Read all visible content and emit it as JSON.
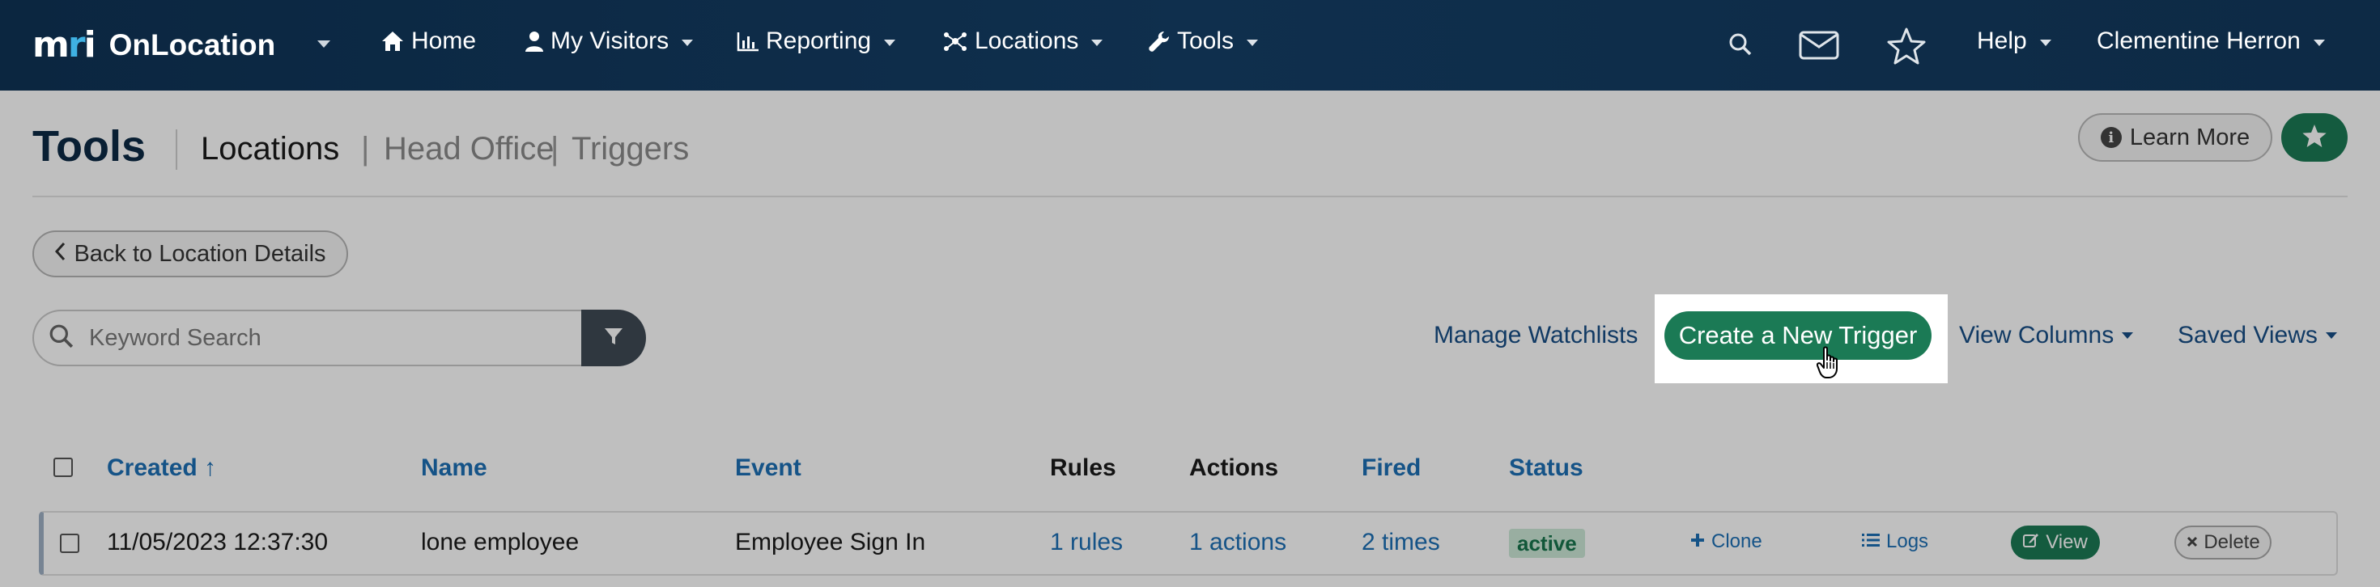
{
  "brand": {
    "logo_text": "mri",
    "product": "OnLocation"
  },
  "nav": {
    "items": [
      {
        "label": "Home",
        "icon": "home-icon"
      },
      {
        "label": "My Visitors",
        "icon": "user-icon"
      },
      {
        "label": "Reporting",
        "icon": "bar-chart-icon"
      },
      {
        "label": "Locations",
        "icon": "network-icon"
      },
      {
        "label": "Tools",
        "icon": "wrench-icon"
      }
    ],
    "help": "Help",
    "user": "Clementine Herron"
  },
  "page": {
    "title": "Tools",
    "breadcrumb": {
      "main": "Locations",
      "sep": "|",
      "sub1": "Head Office",
      "sub2": "Triggers"
    },
    "learn_more": "Learn More",
    "back_button": "Back to Location Details"
  },
  "toolbar": {
    "search_placeholder": "Keyword Search",
    "manage_watchlists": "Manage Watchlists",
    "create_trigger": "Create a New Trigger",
    "view_columns": "View Columns",
    "saved_views": "Saved Views"
  },
  "table": {
    "headers": {
      "created": "Created ↑",
      "name": "Name",
      "event": "Event",
      "rules": "Rules",
      "actions": "Actions",
      "fired": "Fired",
      "status": "Status"
    },
    "rows": [
      {
        "created": "11/05/2023 12:37:30",
        "name": "lone employee",
        "event": "Employee Sign In",
        "rules": "1 rules",
        "actions": "1 actions",
        "fired": "2 times",
        "status": "active",
        "clone": "Clone",
        "logs": "Logs",
        "view": "View",
        "delete": "Delete"
      }
    ]
  },
  "colors": {
    "nav_bg": "#0f2f4d",
    "accent_green": "#1b7a55",
    "link_blue": "#1c6fb5",
    "status_active_bg": "#cce9d7"
  }
}
